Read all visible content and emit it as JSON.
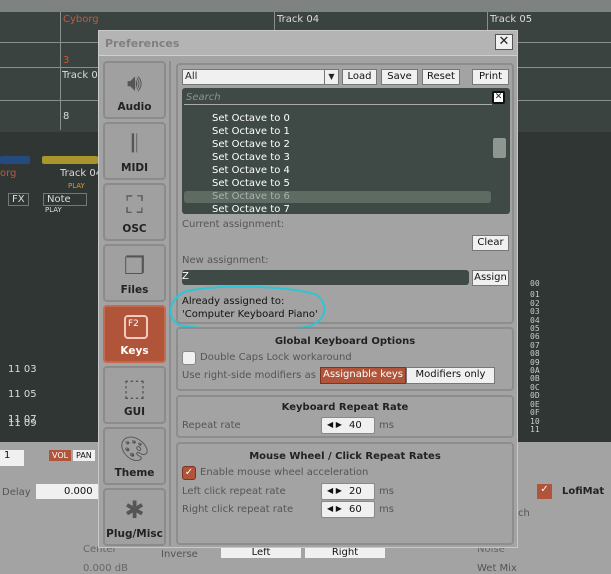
{
  "background": {
    "tracks": [
      "Cyborg",
      "Track 04",
      "Track 05",
      "Track 0"
    ],
    "numbers": [
      "3",
      "8"
    ],
    "mixer": {
      "track_a": "org",
      "track_b": "Track 04",
      "play": "PLAY",
      "fx": "FX",
      "note": "Note",
      "rows": [
        "11 03",
        "11 05",
        "11 07",
        "11 09"
      ],
      "hex_rows": [
        "00",
        "01",
        "02",
        "03",
        "04",
        "05",
        "06",
        "07",
        "08",
        "09",
        "0A",
        "0B",
        "0C",
        "0D",
        "0E",
        "0F",
        "10",
        "11"
      ]
    },
    "bottom": {
      "step": "1",
      "vol": "VOL",
      "pan": "PAN",
      "delay_label": "Delay",
      "delay_value": "0.000",
      "center": "Center",
      "db": "0.000 dB",
      "inverse": "Inverse",
      "left": "Left",
      "right": "Right",
      "lofimat": "LofiMat",
      "ch": "ch",
      "noise": "Noise",
      "wet_mix": "Wet Mix"
    }
  },
  "dialog": {
    "title": "Preferences",
    "close": "✕",
    "sidebar": [
      {
        "label": "Audio",
        "icon": "speaker-icon"
      },
      {
        "label": "MIDI",
        "icon": "piano-keys-icon"
      },
      {
        "label": "OSC",
        "icon": "network-icon"
      },
      {
        "label": "Files",
        "icon": "files-icon"
      },
      {
        "label": "Keys",
        "icon": "f2-key-icon",
        "active": true
      },
      {
        "label": "GUI",
        "icon": "cursor-window-icon"
      },
      {
        "label": "Theme",
        "icon": "palette-icon"
      },
      {
        "label": "Plug/Misc",
        "icon": "puzzle-icon"
      }
    ],
    "keys": {
      "filter_value": "All",
      "load": "Load",
      "save": "Save",
      "reset": "Reset",
      "print": "Print",
      "search_placeholder": "Search",
      "items": [
        "Set Octave to 0",
        "Set Octave to 1",
        "Set Octave to 2",
        "Set Octave to 3",
        "Set Octave to 4",
        "Set Octave to 5",
        "Set Octave to 6",
        "Set Octave to 7"
      ],
      "selected_index": 6,
      "current_assignment_label": "Current assignment:",
      "clear": "Clear",
      "new_assignment_label": "New assignment:",
      "new_assignment_value": "Z",
      "assign": "Assign",
      "already_assigned_label": "Already assigned to:",
      "already_assigned_value": "'Computer Keyboard Piano'"
    },
    "global": {
      "title": "Global Keyboard Options",
      "double_caps": "Double Caps Lock workaround",
      "double_caps_checked": false,
      "right_mod_label": "Use right-side modifiers as",
      "opt_assignable": "Assignable keys",
      "opt_modifiers": "Modifiers only",
      "selected": "Assignable keys"
    },
    "repeat": {
      "title": "Keyboard Repeat Rate",
      "label": "Repeat rate",
      "value": "40",
      "unit": "ms"
    },
    "mouse": {
      "title": "Mouse Wheel / Click Repeat Rates",
      "accel": "Enable mouse wheel acceleration",
      "accel_checked": true,
      "left_label": "Left click repeat rate",
      "left_value": "20",
      "right_label": "Right click repeat rate",
      "right_value": "60",
      "unit": "ms"
    }
  },
  "colors": {
    "accent": "#b0543a",
    "annotation": "#2ec4d6",
    "list_bg": "#3f4a47"
  }
}
